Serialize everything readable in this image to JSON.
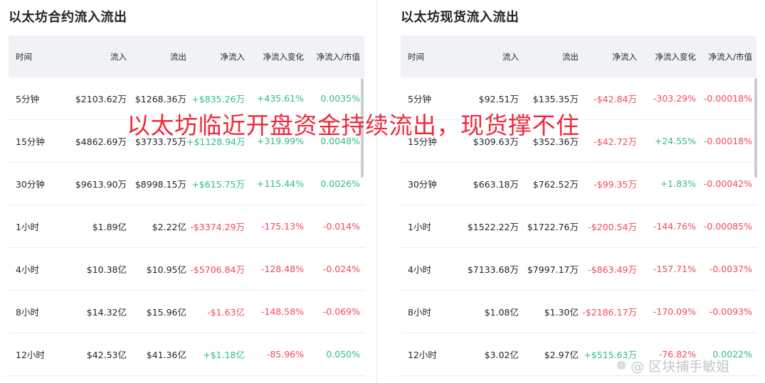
{
  "colors": {
    "positive": "#2ebd85",
    "negative": "#f6465d",
    "overlay": "#ee2a3c"
  },
  "left_panel": {
    "title": "以太坊合约流入流出",
    "headers": [
      "时间",
      "流入",
      "流出",
      "净流入",
      "净流入变化",
      "净流入/市值"
    ],
    "rows": [
      [
        "5分钟",
        "$2103.62万",
        "$1268.36万",
        "+$835.26万",
        "+435.61%",
        "0.0035%"
      ],
      [
        "15分钟",
        "$4862.69万",
        "$3733.75万",
        "+$1128.94万",
        "+319.99%",
        "0.0048%"
      ],
      [
        "30分钟",
        "$9613.90万",
        "$8998.15万",
        "+$615.75万",
        "+115.44%",
        "0.0026%"
      ],
      [
        "1小时",
        "$1.89亿",
        "$2.22亿",
        "-$3374.29万",
        "-175.13%",
        "-0.014%"
      ],
      [
        "4小时",
        "$10.38亿",
        "$10.95亿",
        "-$5706.84万",
        "-128.48%",
        "-0.024%"
      ],
      [
        "8小时",
        "$14.32亿",
        "$15.96亿",
        "-$1.63亿",
        "-148.58%",
        "-0.069%"
      ],
      [
        "12小时",
        "$42.53亿",
        "$41.36亿",
        "+$1.18亿",
        "-85.96%",
        "0.050%"
      ]
    ]
  },
  "right_panel": {
    "title": "以太坊现货流入流出",
    "headers": [
      "时间",
      "流入",
      "流出",
      "净流入",
      "净流入变化",
      "净流入/市值"
    ],
    "rows": [
      [
        "5分钟",
        "$92.51万",
        "$135.35万",
        "-$42.84万",
        "-303.29%",
        "-0.00018%"
      ],
      [
        "15分钟",
        "$309.63万",
        "$352.36万",
        "-$42.72万",
        "+24.55%",
        "-0.00018%"
      ],
      [
        "30分钟",
        "$663.18万",
        "$762.52万",
        "-$99.35万",
        "+1.83%",
        "-0.00042%"
      ],
      [
        "1小时",
        "$1522.22万",
        "$1722.76万",
        "-$200.54万",
        "-144.76%",
        "-0.00085%"
      ],
      [
        "4小时",
        "$7133.68万",
        "$7997.17万",
        "-$863.49万",
        "-157.71%",
        "-0.0037%"
      ],
      [
        "8小时",
        "$1.08亿",
        "$1.30亿",
        "-$2186.17万",
        "-170.09%",
        "-0.0093%"
      ],
      [
        "12小时",
        "$3.02亿",
        "$2.97亿",
        "+$515.63万",
        "-76.82%",
        "0.0022%"
      ]
    ]
  },
  "overlay_text": "以太坊临近开盘资金持续流出，现货撑不住",
  "watermark": {
    "icon": "paw-icon",
    "text": "@ 区块捕手敏姐"
  }
}
